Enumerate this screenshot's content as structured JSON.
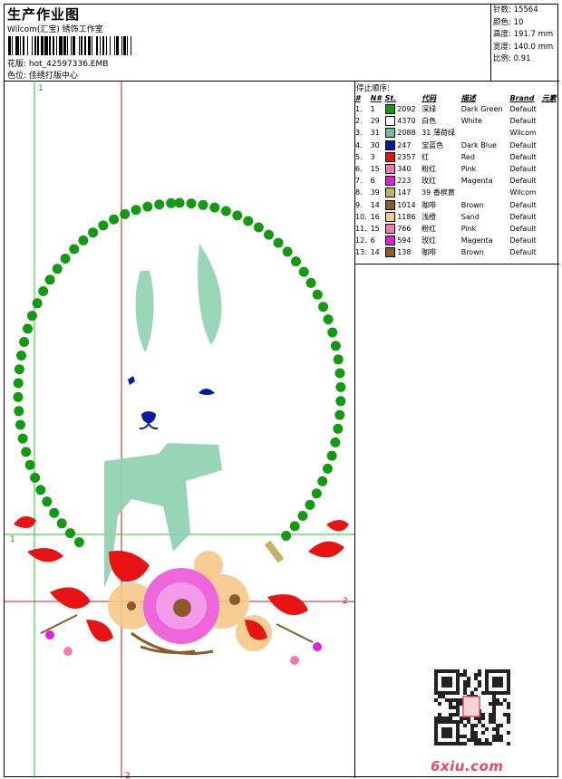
{
  "header": {
    "title": "生产作业图",
    "company": "Wilcom(汇宝) 绣饰工作室",
    "file": "花版: hot_42597336.EMB",
    "color_center": "色位: 佳绣打版中心"
  },
  "stats": {
    "stitches": "针数: 15564",
    "colors": "颜色: 10",
    "height": "高度: 191.7 mm",
    "width": "宽度: 140.0 mm",
    "scale": "比例: 0.91"
  },
  "canvas": {
    "guide_label_top": "1",
    "guide_label_left": "1",
    "guide_label_right": "2",
    "guide_label_bottom": "2"
  },
  "color_table": {
    "stop_title": "停止顺序:",
    "headers": [
      "#",
      "N#",
      "St.",
      "代码",
      "描述",
      "Brand",
      "元素"
    ],
    "rows": [
      {
        "idx": "1.",
        "n": "1",
        "st": "2092",
        "code": "深绿",
        "desc": "Dark Green",
        "brand": "Default",
        "color": "#129a12"
      },
      {
        "idx": "2.",
        "n": "29",
        "st": "4370",
        "code": "白色",
        "desc": "White",
        "brand": "Default",
        "color": "#ffffff"
      },
      {
        "idx": "3.",
        "n": "31",
        "st": "2088",
        "code": "31 薄荷绿",
        "desc": "",
        "brand": "Wilcom",
        "color": "#6cbf9b"
      },
      {
        "idx": "4.",
        "n": "30",
        "st": "247",
        "code": "宝蓝色",
        "desc": "Dark Blue",
        "brand": "Default",
        "color": "#0a1aa0"
      },
      {
        "idx": "5.",
        "n": "3",
        "st": "2357",
        "code": "红",
        "desc": "Red",
        "brand": "Default",
        "color": "#e81414"
      },
      {
        "idx": "6.",
        "n": "15",
        "st": "340",
        "code": "粉红",
        "desc": "Pink",
        "brand": "Default",
        "color": "#f27ab0"
      },
      {
        "idx": "7.",
        "n": "6",
        "st": "223",
        "code": "玫红",
        "desc": "Magenta",
        "brand": "Default",
        "color": "#e020d8"
      },
      {
        "idx": "8.",
        "n": "39",
        "st": "147",
        "code": "39 香槟黄",
        "desc": "",
        "brand": "Wilcom",
        "color": "#bdb46a"
      },
      {
        "idx": "9.",
        "n": "14",
        "st": "1014",
        "code": "咖啡",
        "desc": "Brown",
        "brand": "Default",
        "color": "#8a5a2a"
      },
      {
        "idx": "10.",
        "n": "16",
        "st": "1186",
        "code": "浅橙",
        "desc": "Sand",
        "brand": "Default",
        "color": "#f6c88a"
      },
      {
        "idx": "11.",
        "n": "15",
        "st": "766",
        "code": "粉红",
        "desc": "Pink",
        "brand": "Default",
        "color": "#f27ab0"
      },
      {
        "idx": "12.",
        "n": "6",
        "st": "594",
        "code": "玫红",
        "desc": "Magenta",
        "brand": "Default",
        "color": "#e020d8"
      },
      {
        "idx": "13.",
        "n": "14",
        "st": "138",
        "code": "咖啡",
        "desc": "Brown",
        "brand": "Default",
        "color": "#8a5a2a"
      }
    ]
  },
  "watermark": "6xiu.com"
}
